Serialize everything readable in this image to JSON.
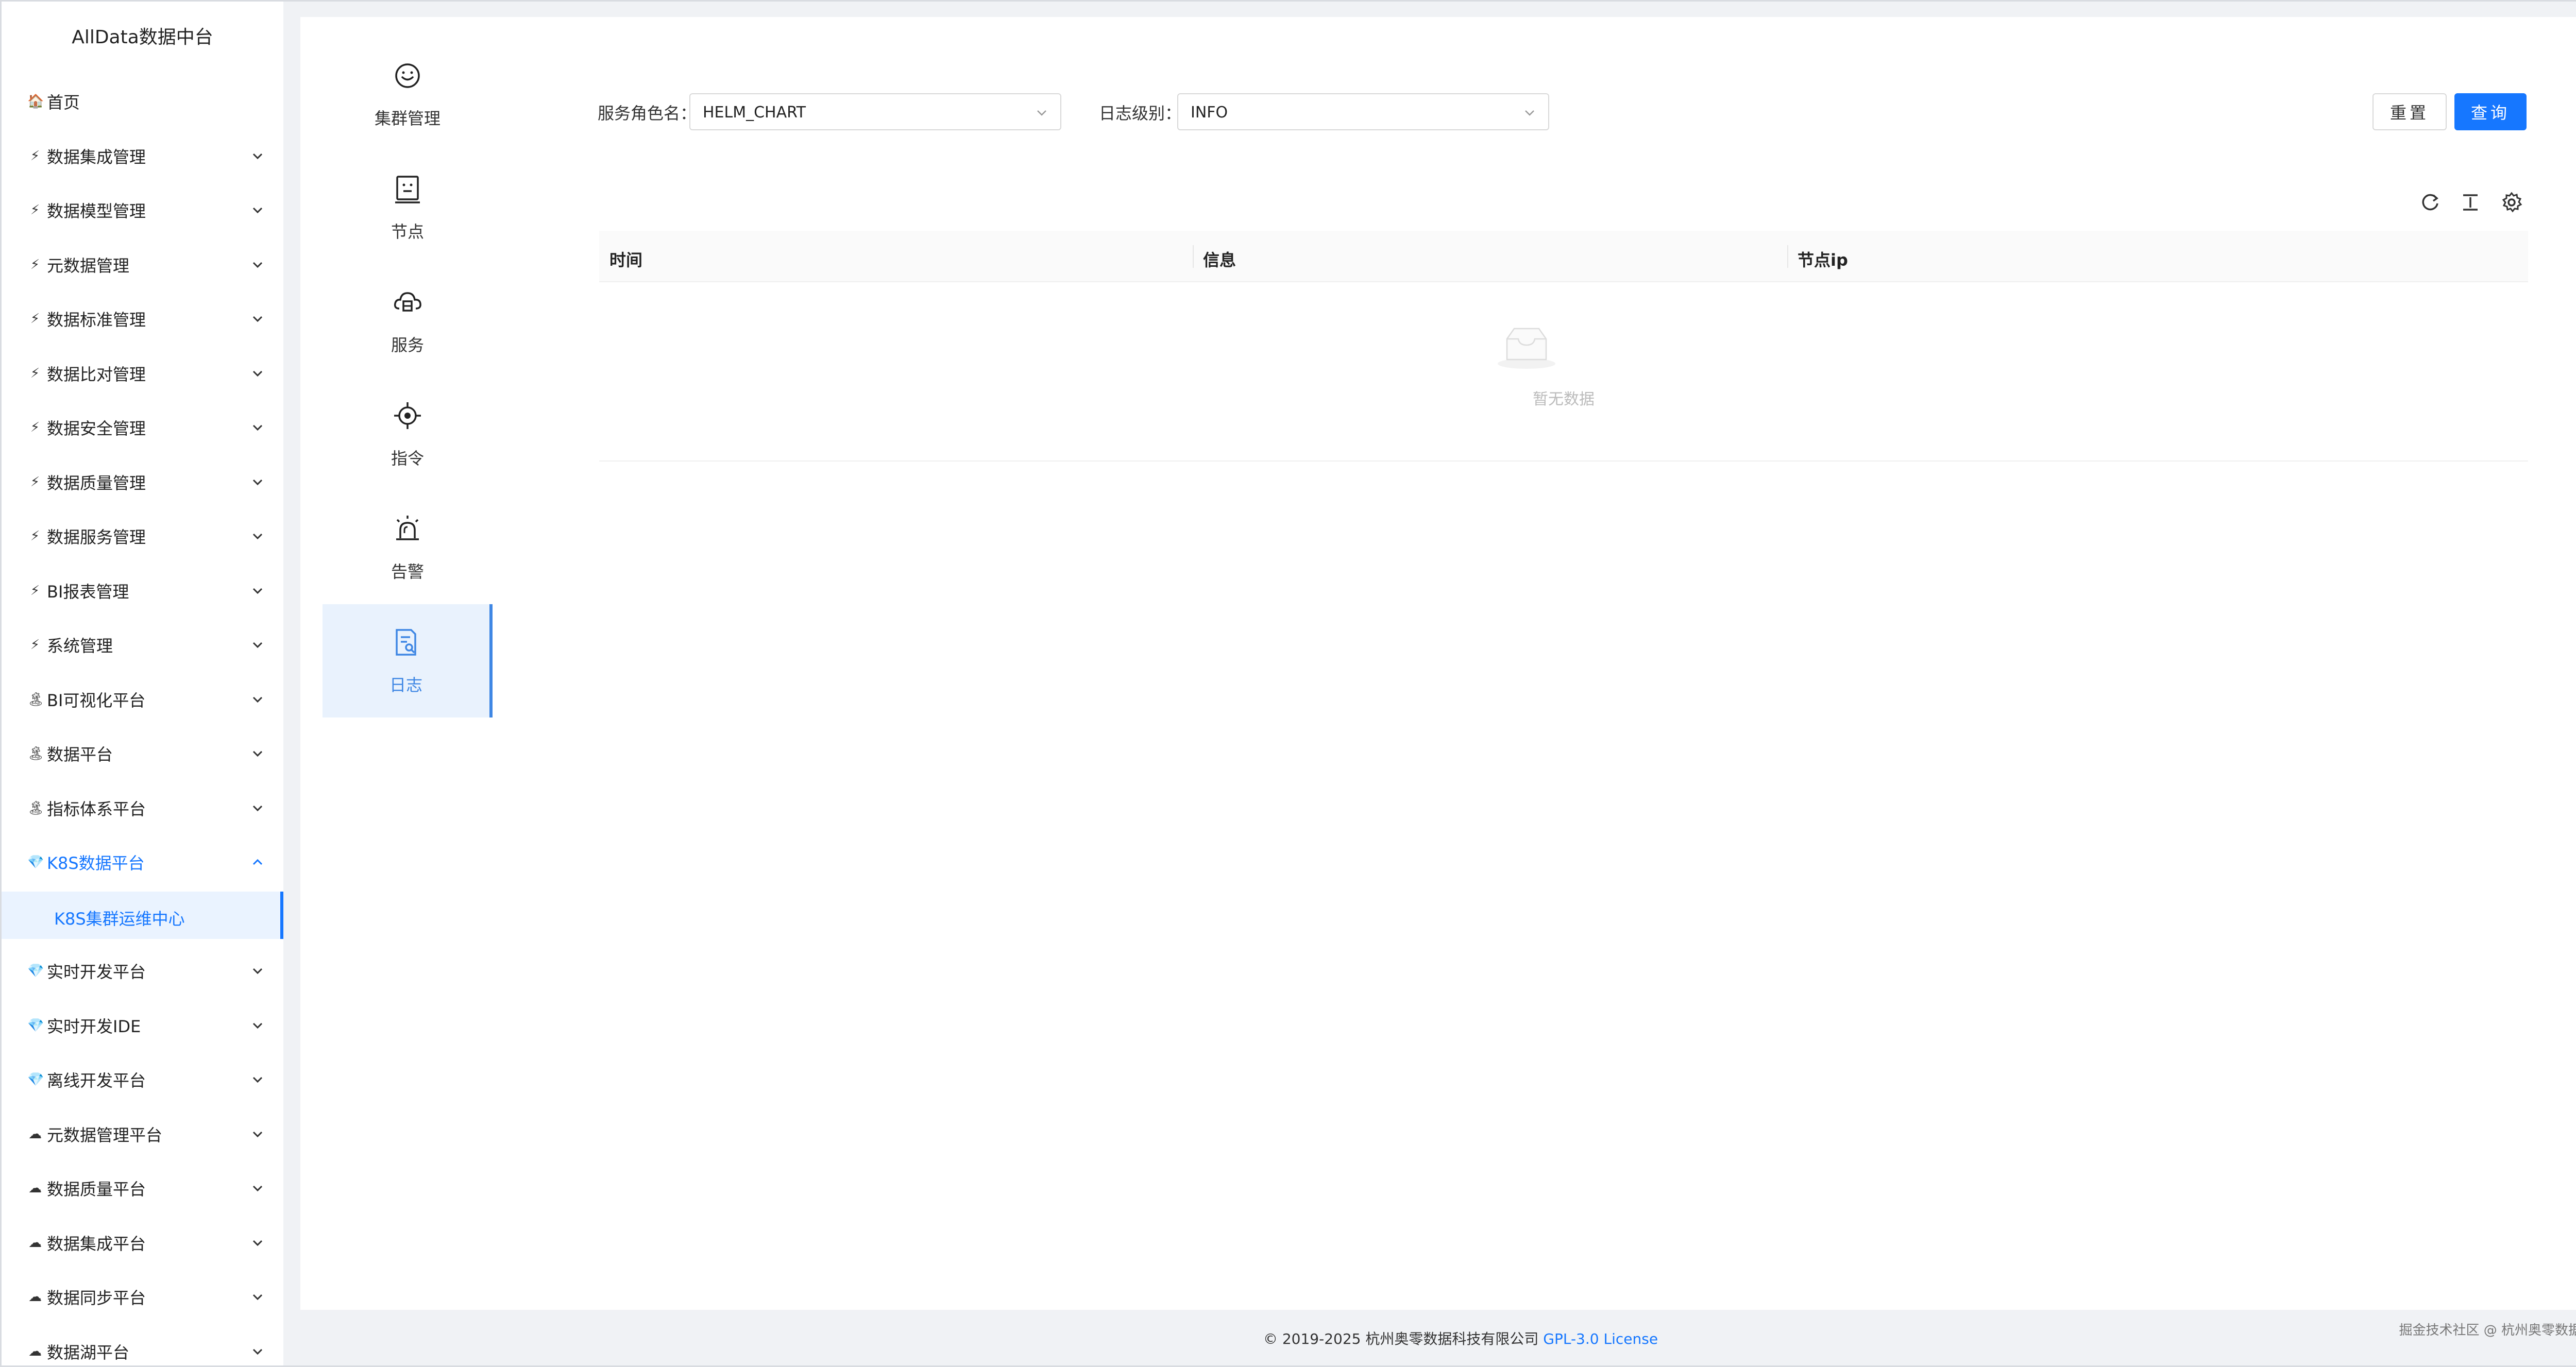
{
  "app": {
    "title": "AllData数据中台"
  },
  "sidebar": {
    "items": [
      {
        "icon": "house-icon",
        "glyph": "🏠",
        "label": "首页",
        "has_children": false
      },
      {
        "icon": "lightning-icon",
        "glyph": "⚡",
        "label": "数据集成管理",
        "has_children": true
      },
      {
        "icon": "lightning-icon",
        "glyph": "⚡",
        "label": "数据模型管理",
        "has_children": true
      },
      {
        "icon": "lightning-icon",
        "glyph": "⚡",
        "label": "元数据管理",
        "has_children": true
      },
      {
        "icon": "lightning-icon",
        "glyph": "⚡",
        "label": "数据标准管理",
        "has_children": true
      },
      {
        "icon": "lightning-icon",
        "glyph": "⚡",
        "label": "数据比对管理",
        "has_children": true
      },
      {
        "icon": "lightning-icon",
        "glyph": "⚡",
        "label": "数据安全管理",
        "has_children": true
      },
      {
        "icon": "lightning-icon",
        "glyph": "⚡",
        "label": "数据质量管理",
        "has_children": true
      },
      {
        "icon": "lightning-icon",
        "glyph": "⚡",
        "label": "数据服务管理",
        "has_children": true
      },
      {
        "icon": "lightning-icon",
        "glyph": "⚡",
        "label": "BI报表管理",
        "has_children": true
      },
      {
        "icon": "lightning-icon",
        "glyph": "⚡",
        "label": "系统管理",
        "has_children": true
      },
      {
        "icon": "island-icon",
        "glyph": "🏝",
        "label": "BI可视化平台",
        "has_children": true
      },
      {
        "icon": "island-icon",
        "glyph": "🏝",
        "label": "数据平台",
        "has_children": true
      },
      {
        "icon": "island-icon",
        "glyph": "🏝",
        "label": "指标体系平台",
        "has_children": true
      },
      {
        "icon": "gem-icon",
        "glyph": "💎",
        "label": "K8S数据平台",
        "has_children": true,
        "open": true
      },
      {
        "icon": "gem-icon",
        "glyph": "💎",
        "label": "实时开发平台",
        "has_children": true
      },
      {
        "icon": "gem-icon",
        "glyph": "💎",
        "label": "实时开发IDE",
        "has_children": true
      },
      {
        "icon": "gem-icon",
        "glyph": "💎",
        "label": "离线开发平台",
        "has_children": true
      },
      {
        "icon": "cloud-icon",
        "glyph": "☁",
        "label": "元数据管理平台",
        "has_children": true
      },
      {
        "icon": "cloud-icon",
        "glyph": "☁",
        "label": "数据质量平台",
        "has_children": true
      },
      {
        "icon": "cloud-icon",
        "glyph": "☁",
        "label": "数据集成平台",
        "has_children": true
      },
      {
        "icon": "cloud-icon",
        "glyph": "☁",
        "label": "数据同步平台",
        "has_children": true
      },
      {
        "icon": "cloud-icon",
        "glyph": "☁",
        "label": "数据湖平台",
        "has_children": true
      }
    ],
    "active_submenu": "K8S集群运维中心"
  },
  "subnav": {
    "items": [
      {
        "icon": "smiley-icon",
        "label": "集群管理"
      },
      {
        "icon": "node-icon",
        "label": "节点"
      },
      {
        "icon": "service-cloud-icon",
        "label": "服务"
      },
      {
        "icon": "target-icon",
        "label": "指令"
      },
      {
        "icon": "alarm-icon",
        "label": "告警"
      },
      {
        "icon": "log-search-icon",
        "label": "日志",
        "active": true
      }
    ]
  },
  "filters": {
    "role_label": "服务角色名：",
    "role_value": "HELM_CHART",
    "level_label": "日志级别：",
    "level_value": "INFO",
    "reset_label": "重置",
    "query_label": "查询"
  },
  "table": {
    "columns": [
      "时间",
      "信息",
      "节点ip"
    ],
    "empty_text": "暂无数据"
  },
  "footer": {
    "copyright": "© 2019-2025 杭州奥零数据科技有限公司",
    "license": "GPL-3.0 License",
    "watermark": "掘金技术社区 @ 杭州奥零数据科技"
  },
  "colors": {
    "accent": "#1677ff",
    "active_bg": "#e9f2fd"
  }
}
